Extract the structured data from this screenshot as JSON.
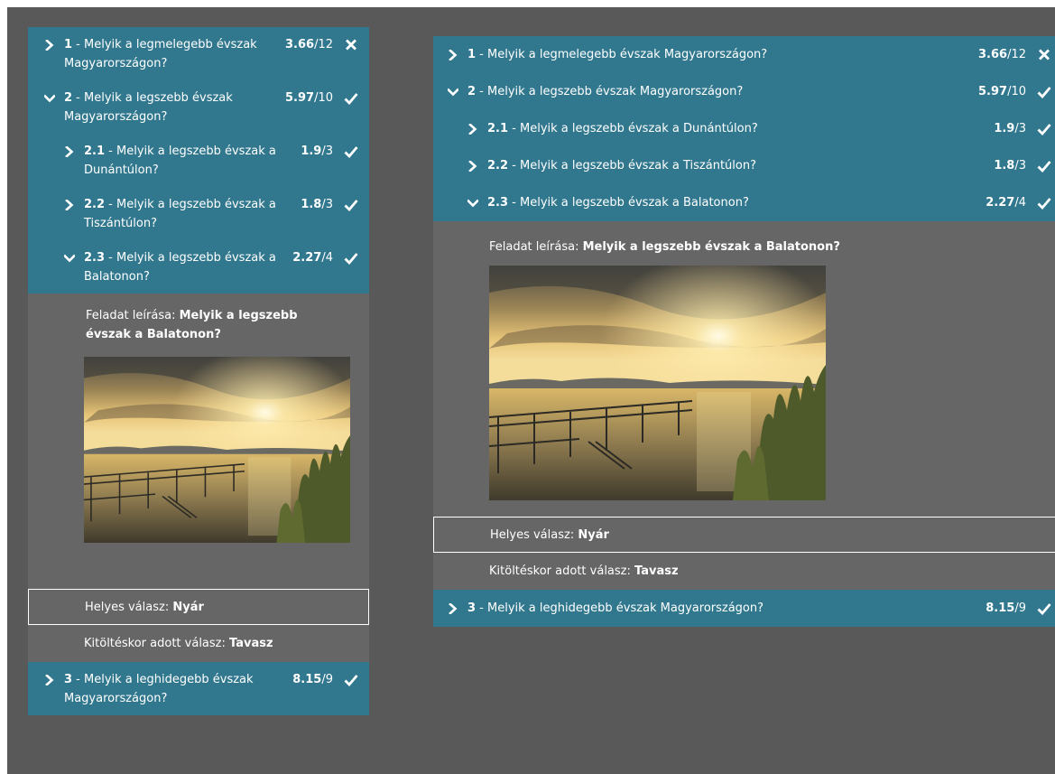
{
  "questions": [
    {
      "number": "1",
      "text": "Melyik a legmelegebb évszak Magyarországon?",
      "score": "3.66",
      "max": "/12",
      "status": "incorrect",
      "expanded": false
    },
    {
      "number": "2",
      "text": "Melyik a legszebb évszak Magyarországon?",
      "score": "5.97",
      "max": "/10",
      "status": "correct",
      "expanded": true
    },
    {
      "number": "2.1",
      "text": "Melyik a legszebb évszak a Dunántúlon?",
      "score": "1.9",
      "max": "/3",
      "status": "correct",
      "expanded": false
    },
    {
      "number": "2.2",
      "text": "Melyik a legszebb évszak a Tiszántúlon?",
      "score": "1.8",
      "max": "/3",
      "status": "correct",
      "expanded": false
    },
    {
      "number": "2.3",
      "text": "Melyik a legszebb évszak a Balatonon?",
      "score": "2.27",
      "max": "/4",
      "status": "correct",
      "expanded": true
    },
    {
      "number": "3",
      "text": "Melyik a leghidegebb évszak Magyarországon?",
      "score": "8.15",
      "max": "/9",
      "status": "correct",
      "expanded": false
    }
  ],
  "separator": " - ",
  "detail": {
    "description_label": "Feladat leírása: ",
    "description_value": "Melyik a legszebb évszak a Balatonon?",
    "correct_label": "Helyes válasz: ",
    "correct_value": "Nyár",
    "given_label": "Kitöltéskor adott válasz: ",
    "given_value": "Tavasz"
  },
  "colors": {
    "row_bg": "#31788f",
    "detail_bg": "#666666",
    "page_bg": "#595959"
  },
  "icons": {
    "collapsed": "chevron-right-icon",
    "expanded": "chevron-down-icon",
    "correct": "checkmark-icon",
    "incorrect": "cross-icon"
  }
}
